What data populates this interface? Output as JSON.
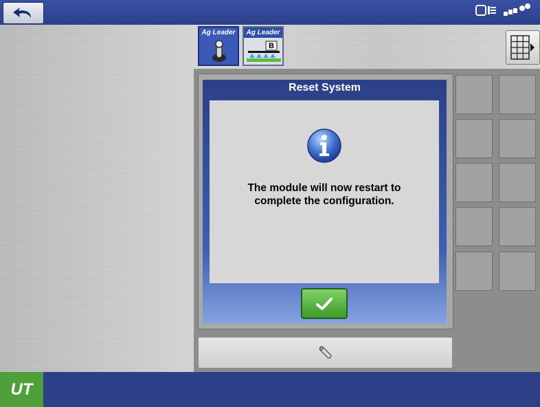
{
  "topbar": {
    "back_icon": "undo-arrow-icon",
    "status_icons": [
      "display-console-icon",
      "gps-satellite-icon"
    ]
  },
  "tabs": [
    {
      "brand": "Ag Leader",
      "icon": "joystick-icon",
      "active": true
    },
    {
      "brand": "Ag Leader",
      "icon": "sprayer-boom-icon",
      "badge": "B",
      "active": false
    }
  ],
  "grid_button": {
    "icon": "grid-layout-icon"
  },
  "dialog": {
    "title": "Reset System",
    "message_line1": "The module will now restart to",
    "message_line2": "complete the configuration.",
    "icon": "info-icon",
    "ok_icon": "checkmark-icon"
  },
  "toolbar": {
    "wrench_icon": "wrench-icon"
  },
  "bottombar": {
    "ut_label": "UT"
  },
  "colors": {
    "bar_blue": "#2d3f86",
    "ok_green": "#4ca83a",
    "ut_green": "#4f9f3a"
  }
}
